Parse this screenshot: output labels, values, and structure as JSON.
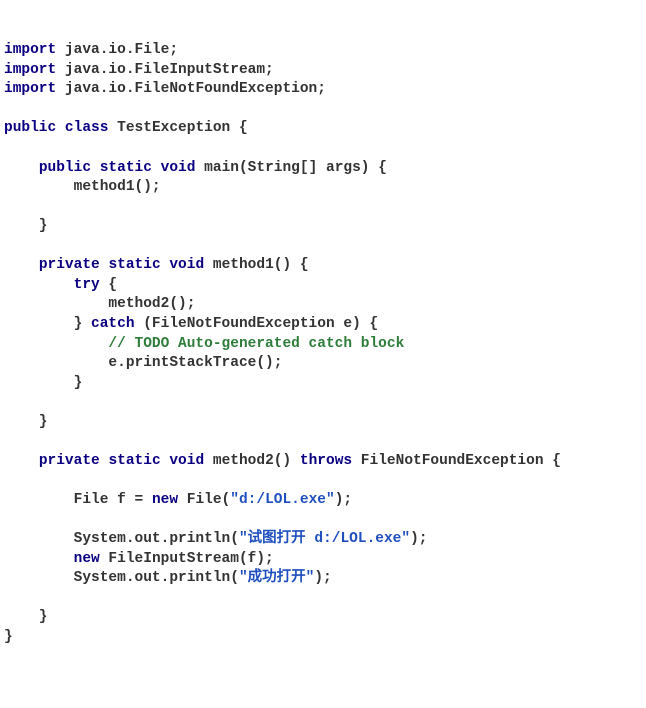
{
  "code": {
    "import_kw": "import",
    "pkg_file": " java.io.File;",
    "pkg_fis": " java.io.FileInputStream;",
    "pkg_fnfe": " java.io.FileNotFoundException;",
    "public_kw": "public",
    "class_kw": "class",
    "class_name": " TestException {",
    "static_kw": "static",
    "void_kw": "void",
    "main_sig": " main(String[] args) {",
    "main_body": "        method1();",
    "private_kw": "private",
    "m1_sig": " method1() {",
    "try_kw": "try",
    "try_open": " {",
    "try_body": "            method2();",
    "catch_close": "        } ",
    "catch_kw": "catch",
    "catch_sig": " (FileNotFoundException e) {",
    "todo": "            // TODO Auto-generated catch block",
    "pst": "            e.printStackTrace();",
    "brace_close3": "        }",
    "m2_sig": " method2() ",
    "throws_kw": "throws",
    "throws_type": " FileNotFoundException {",
    "new_kw": "new",
    "file_decl_a": "        File f = ",
    "file_decl_b": " File(",
    "str_path": "\"d:/LOL.exe\"",
    "file_decl_c": ");",
    "sysout_a": "        System.out.println(",
    "str_tryopen": "\"试图打开 d:/LOL.exe\"",
    "close_paren": ");",
    "fis_a": "        ",
    "fis_b": " FileInputStream(f);",
    "str_ok": "\"成功打开\"",
    "brace_close2": "    }",
    "brace_close1": "}",
    "sp1": " ",
    "indent2": "    ",
    "indent3": "        "
  }
}
